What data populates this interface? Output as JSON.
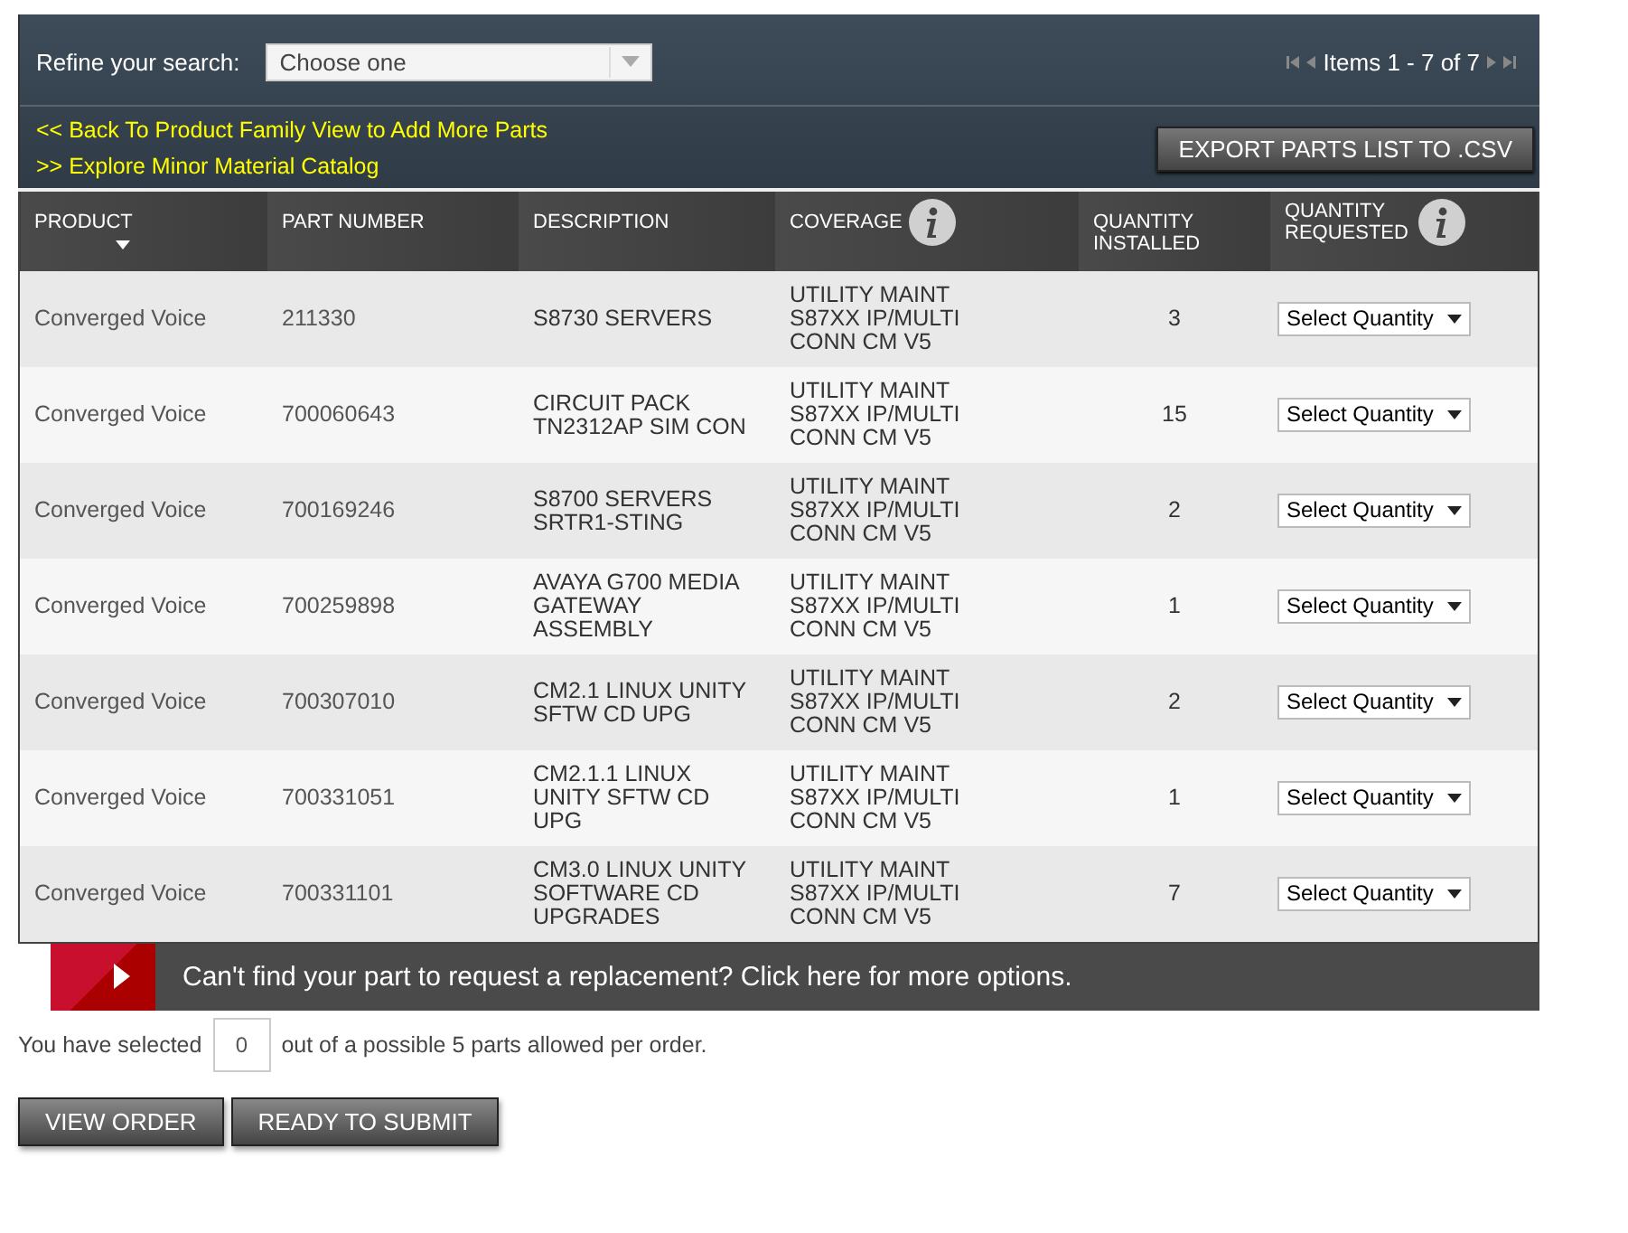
{
  "filter": {
    "label": "Refine your search:",
    "placeholder": "Choose one"
  },
  "pager": {
    "text": "Items 1 - 7 of 7"
  },
  "links": [
    "<< Back To Product Family View to Add More Parts",
    ">> Explore Minor Material Catalog"
  ],
  "export_button": "EXPORT PARTS LIST TO .CSV",
  "table": {
    "columns": [
      {
        "label": "PRODUCT",
        "sorted": true,
        "info": false
      },
      {
        "label": "PART NUMBER",
        "sorted": false,
        "info": false
      },
      {
        "label": "DESCRIPTION",
        "sorted": false,
        "info": false
      },
      {
        "label": "COVERAGE",
        "sorted": false,
        "info": true
      },
      {
        "label": "QUANTITY INSTALLED",
        "sorted": false,
        "info": false
      },
      {
        "label": "QUANTITY REQUESTED",
        "sorted": false,
        "info": true
      }
    ],
    "rows": [
      {
        "product": "Converged Voice",
        "part_number": "211330",
        "description": "S8730 SERVERS",
        "coverage": "UTILITY MAINT S87XX IP/MULTI CONN CM V5",
        "installed": "3",
        "requested": "Select Quantity"
      },
      {
        "product": "Converged Voice",
        "part_number": "700060643",
        "description": "CIRCUIT PACK TN2312AP SIM CON",
        "coverage": "UTILITY MAINT S87XX IP/MULTI CONN CM V5",
        "installed": "15",
        "requested": "Select Quantity"
      },
      {
        "product": "Converged Voice",
        "part_number": "700169246",
        "description": "S8700 SERVERS SRTR1-STING",
        "coverage": "UTILITY MAINT S87XX IP/MULTI CONN CM V5",
        "installed": "2",
        "requested": "Select Quantity"
      },
      {
        "product": "Converged Voice",
        "part_number": "700259898",
        "description": "AVAYA G700 MEDIA GATEWAY ASSEMBLY",
        "coverage": "UTILITY MAINT S87XX IP/MULTI CONN CM V5",
        "installed": "1",
        "requested": "Select Quantity"
      },
      {
        "product": "Converged Voice",
        "part_number": "700307010",
        "description": "CM2.1 LINUX UNITY SFTW CD UPG",
        "coverage": "UTILITY MAINT S87XX IP/MULTI CONN CM V5",
        "installed": "2",
        "requested": "Select Quantity"
      },
      {
        "product": "Converged Voice",
        "part_number": "700331051",
        "description": "CM2.1.1 LINUX UNITY SFTW CD UPG",
        "coverage": "UTILITY MAINT S87XX IP/MULTI CONN CM V5",
        "installed": "1",
        "requested": "Select Quantity"
      },
      {
        "product": "Converged Voice",
        "part_number": "700331101",
        "description": "CM3.0 LINUX UNITY SOFTWARE CD UPGRADES",
        "coverage": "UTILITY MAINT S87XX IP/MULTI CONN CM V5",
        "installed": "7",
        "requested": "Select Quantity"
      }
    ]
  },
  "banner": "Can't find your part to request a replacement? Click here for more options.",
  "selection": {
    "before": "You have selected",
    "value": "0",
    "after": "out of a possible 5 parts allowed per order."
  },
  "buttons": [
    "VIEW ORDER",
    "READY TO SUBMIT"
  ]
}
